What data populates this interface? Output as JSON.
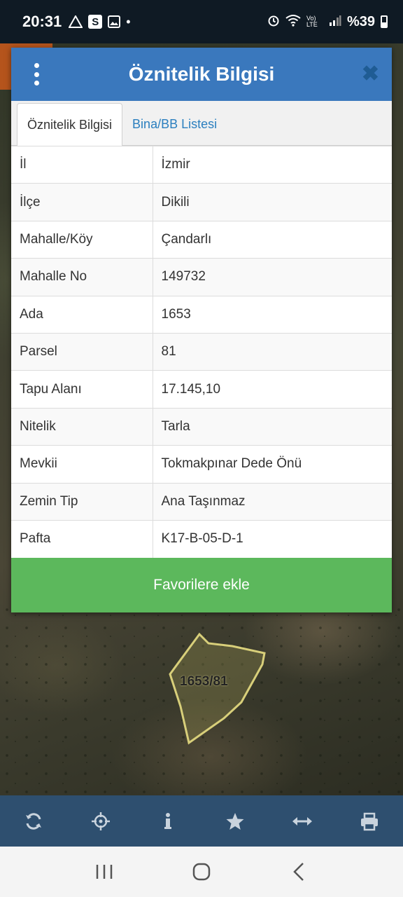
{
  "status_bar": {
    "time": "20:31",
    "notification_dot": "•",
    "network": "Vo) LTE",
    "battery": "%39"
  },
  "dialog": {
    "title": "Öznitelik Bilgisi",
    "tabs": [
      {
        "label": "Öznitelik Bilgisi",
        "active": true
      },
      {
        "label": "Bina/BB Listesi",
        "active": false
      }
    ],
    "rows": [
      {
        "key": "İl",
        "value": "İzmir"
      },
      {
        "key": "İlçe",
        "value": "Dikili"
      },
      {
        "key": "Mahalle/Köy",
        "value": "Çandarlı"
      },
      {
        "key": "Mahalle No",
        "value": "149732"
      },
      {
        "key": "Ada",
        "value": "1653"
      },
      {
        "key": "Parsel",
        "value": "81"
      },
      {
        "key": "Tapu Alanı",
        "value": "17.145,10"
      },
      {
        "key": "Nitelik",
        "value": "Tarla"
      },
      {
        "key": "Mevkii",
        "value": "Tokmakpınar Dede Önü"
      },
      {
        "key": "Zemin Tip",
        "value": "Ana Taşınmaz"
      },
      {
        "key": "Pafta",
        "value": "K17-B-05-D-1"
      }
    ],
    "favorite_button": "Favorilere ekle"
  },
  "map": {
    "parcel_label": "1653/81",
    "parcel_outline_color": "#d8cf7a"
  },
  "toolbar": {
    "icons": [
      "refresh-icon",
      "locate-icon",
      "info-icon",
      "star-icon",
      "measure-icon",
      "print-icon"
    ]
  },
  "colors": {
    "header": "#3a78bd",
    "tab_link": "#2b7fbf",
    "favorite": "#5cb85c",
    "toolbar": "#2e4f6f"
  }
}
